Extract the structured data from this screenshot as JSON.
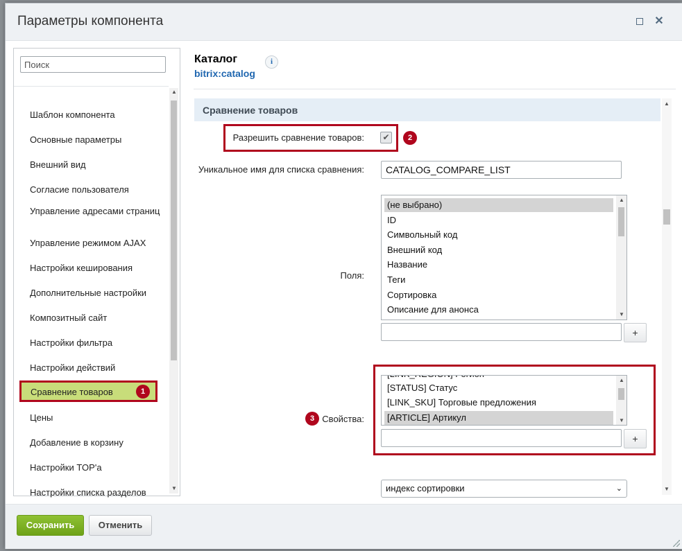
{
  "dialog": {
    "title": "Параметры компонента",
    "maximize_icon": "maximize-icon",
    "close_icon": "close-icon",
    "close_glyph": "✕"
  },
  "sidebar": {
    "search_placeholder": "Поиск",
    "items": [
      {
        "label": "Шаблон компонента"
      },
      {
        "label": "Основные параметры"
      },
      {
        "label": "Внешний вид"
      },
      {
        "label": "Согласие пользователя"
      },
      {
        "label": "Управление адресами страниц"
      },
      {
        "label": "Управление режимом AJAX"
      },
      {
        "label": "Настройки кеширования"
      },
      {
        "label": "Дополнительные настройки"
      },
      {
        "label": "Композитный сайт"
      },
      {
        "label": "Настройки фильтра"
      },
      {
        "label": "Настройки действий"
      },
      {
        "label": "Сравнение товаров",
        "active": true
      },
      {
        "label": "Цены"
      },
      {
        "label": "Добавление в корзину"
      },
      {
        "label": "Настройки TOP'а"
      },
      {
        "label": "Настройки списка разделов"
      }
    ]
  },
  "component": {
    "title": "Каталог",
    "code": "bitrix:catalog",
    "info_glyph": "i"
  },
  "section": {
    "title": "Сравнение товаров",
    "allow_compare": {
      "label": "Разрешить сравнение товаров:",
      "checked": true,
      "check_glyph": "✔"
    },
    "compare_name": {
      "label": "Уникальное имя для списка сравнения:",
      "value": "CATALOG_COMPARE_LIST"
    },
    "fields": {
      "label": "Поля:",
      "options": [
        {
          "text": "(не выбрано)",
          "selected": true
        },
        {
          "text": "ID"
        },
        {
          "text": "Символьный код"
        },
        {
          "text": "Внешний код"
        },
        {
          "text": "Название"
        },
        {
          "text": "Теги"
        },
        {
          "text": "Сортировка"
        },
        {
          "text": "Описание для анонса"
        }
      ],
      "extra_value": "",
      "add_label": "+"
    },
    "properties": {
      "label": "Свойства:",
      "partial_option": "[LINK_REGION] Регион",
      "options": [
        {
          "text": "[STATUS] Статус"
        },
        {
          "text": "[LINK_SKU] Торговые предложения"
        },
        {
          "text": "[ARTICLE] Артикул",
          "selected": true
        }
      ],
      "extra_value": "",
      "add_label": "+"
    },
    "sort_select": {
      "value": "индекс сортировки",
      "chevron_glyph": "⌄"
    }
  },
  "annotations": {
    "badge1": "1",
    "badge2": "2",
    "badge3": "3",
    "highlight_color": "#b0061d"
  },
  "footer": {
    "save_label": "Сохранить",
    "cancel_label": "Отменить"
  },
  "colors": {
    "save_green": "#7bb024",
    "active_item": "#c8dd7a",
    "section_bg": "#e5eef6",
    "link_blue": "#2067b0"
  }
}
